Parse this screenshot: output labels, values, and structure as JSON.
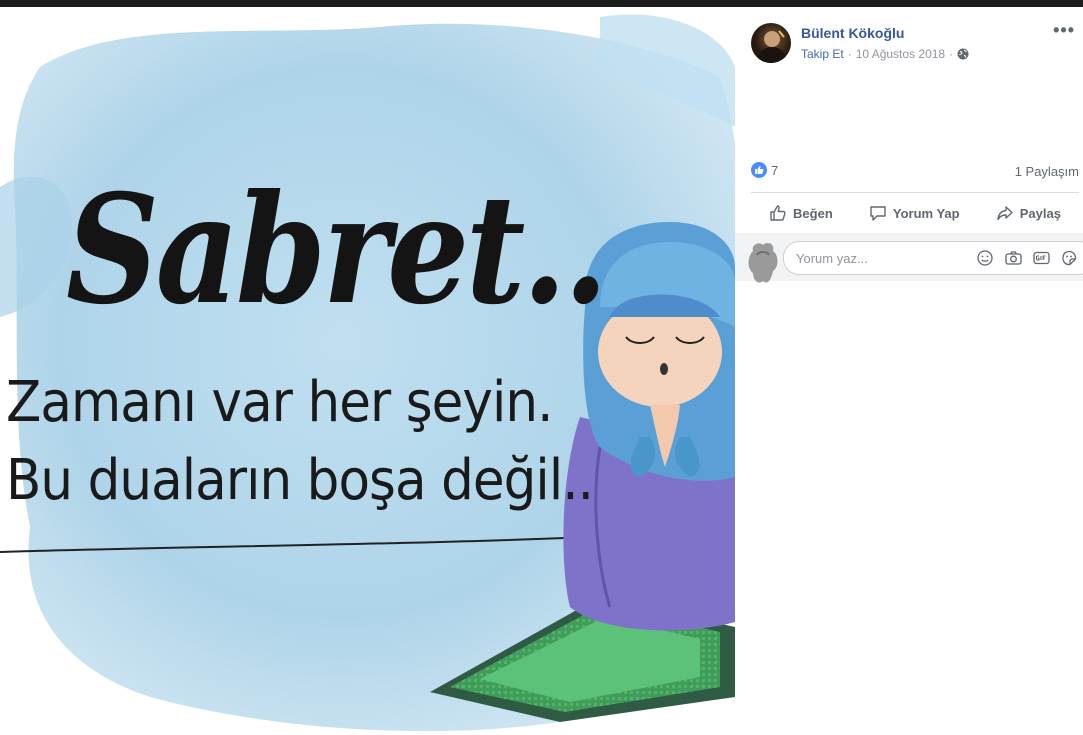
{
  "post": {
    "author": "Bülent Kökoğlu",
    "follow_label": "Takip Et",
    "separator": "·",
    "date": "10 Ağustos 2018",
    "privacy_icon": "globe-icon",
    "more_label": "•••"
  },
  "image_text": {
    "title": "Sabret..",
    "line1": "Zamanı var her şeyin.",
    "line2": "Bu duaların boşa değil.."
  },
  "reactions": {
    "like_count": "7",
    "shares": "1 Paylaşım"
  },
  "actions": {
    "like": "Beğen",
    "comment": "Yorum Yap",
    "share": "Paylaş"
  },
  "comment": {
    "placeholder": "Yorum yaz...",
    "icons": [
      "emoji-icon",
      "camera-icon",
      "gif-icon",
      "sticker-icon"
    ]
  },
  "colors": {
    "link": "#365899",
    "like_blue": "#4a8cff",
    "muted": "#90949c"
  }
}
